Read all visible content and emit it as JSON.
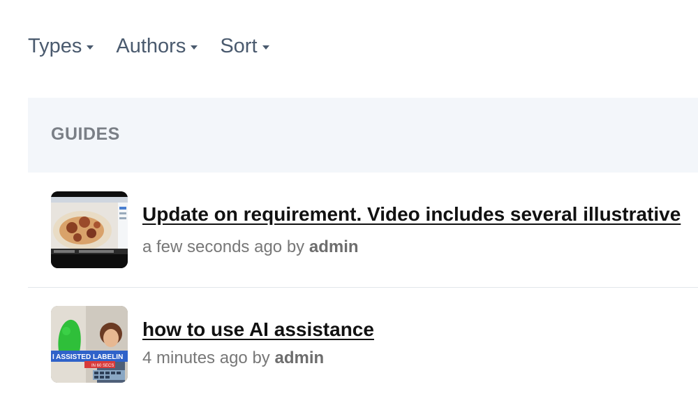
{
  "filters": [
    {
      "label": "Types"
    },
    {
      "label": "Authors"
    },
    {
      "label": "Sort"
    }
  ],
  "section": {
    "title": "GUIDES"
  },
  "items": [
    {
      "title": "Update on requirement. Video includes several illustrative",
      "time": "a few seconds ago",
      "by": "by",
      "author": "admin",
      "thumb_icon": "video-thumbnail-food-icon"
    },
    {
      "title": "how to use AI assistance",
      "time": "4 minutes ago",
      "by": "by",
      "author": "admin",
      "thumb_icon": "video-thumbnail-person-icon",
      "thumb_banner": "I ASSISTED LABELIN",
      "thumb_subbanner": "IN 60 SECS"
    }
  ],
  "colors": {
    "filter_text": "#4a5a6e",
    "section_bg": "#f3f6fa",
    "section_text": "#7a7f86",
    "title_text": "#111111",
    "meta_text": "#777777"
  }
}
